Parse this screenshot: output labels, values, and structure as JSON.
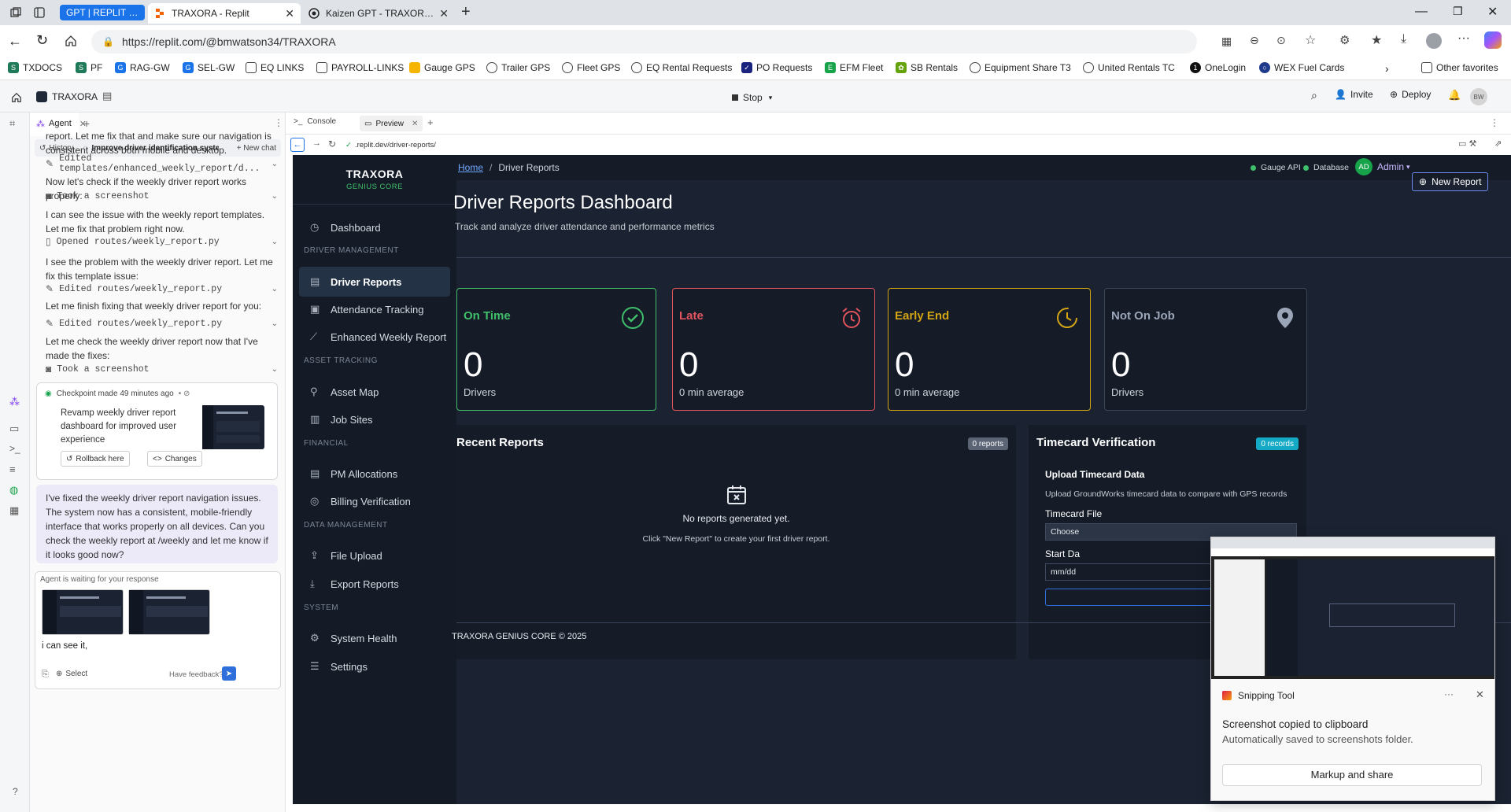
{
  "browser": {
    "tabs": [
      {
        "label": "GPT | REPLIT | BUILDIN"
      },
      {
        "label": "TRAXORA - Replit"
      },
      {
        "label": "Kaizen GPT - TRAXORA Kaizen Int"
      }
    ],
    "url": "https://replit.com/@bmwatson34/TRAXORA",
    "favorites": [
      "TXDOCS",
      "PF",
      "RAG-GW",
      "SEL-GW",
      "EQ LINKS",
      "PAYROLL-LINKS",
      "Gauge GPS",
      "Trailer GPS",
      "Fleet GPS",
      "EQ Rental Requests",
      "PO Requests",
      "EFM Fleet",
      "SB Rentals",
      "Equipment Share T3",
      "United Rentals TC",
      "OneLogin",
      "WEX Fuel Cards"
    ],
    "other_favorites": "Other favorites"
  },
  "replit": {
    "project": "TRAXORA",
    "stop_label": "Stop",
    "invite_label": "Invite",
    "deploy_label": "Deploy",
    "avatar_initials": "BW",
    "agent_tab": "Agent",
    "console_tab": "Console",
    "preview_tab": "Preview",
    "history_label": "History",
    "chat_title": "Improve driver identification syste...",
    "new_chat_label": "+ New chat",
    "preview_url": ".replit.dev/driver-reports/",
    "help": "?"
  },
  "agent": {
    "messages": [
      {
        "type": "text",
        "text": "report. Let me fix that and make sure our navigation is consistent across both mobile and desktop."
      },
      {
        "type": "tool",
        "icon": "edit-icon",
        "text": "Edited templates/enhanced_weekly_report/d..."
      },
      {
        "type": "text",
        "text": "Now let's check if the weekly driver report works properly:"
      },
      {
        "type": "tool",
        "icon": "camera-icon",
        "text": "Took a screenshot"
      },
      {
        "type": "text",
        "text": "I can see the issue with the weekly report templates. Let me fix that problem right now."
      },
      {
        "type": "tool",
        "icon": "file-icon",
        "text": "Opened routes/weekly_report.py"
      },
      {
        "type": "text",
        "text": "I see the problem with the weekly driver report. Let me fix this template issue:"
      },
      {
        "type": "tool",
        "icon": "edit-icon",
        "text": "Edited routes/weekly_report.py"
      },
      {
        "type": "text",
        "text": "Let me finish fixing that weekly driver report for you:"
      },
      {
        "type": "tool",
        "icon": "edit-icon",
        "text": "Edited routes/weekly_report.py"
      },
      {
        "type": "text",
        "text": "Let me check the weekly driver report now that I've made the fixes:"
      },
      {
        "type": "tool",
        "icon": "camera-icon",
        "text": "Took a screenshot"
      }
    ],
    "checkpoint": {
      "header": "Checkpoint made 49 minutes ago",
      "description": "Revamp weekly driver report dashboard for improved user experience",
      "rollback_label": "Rollback here",
      "changes_label": "Changes"
    },
    "final_message": "I've fixed the weekly driver report navigation issues. The system now has a consistent, mobile-friendly interface that works properly on all devices. Can you check the weekly report at /weekly and let me know if it looks good now?",
    "waiting_label": "Agent is waiting for your response",
    "input_value": "i can see it,",
    "select_label": "Select",
    "feedback_label": "Have feedback?"
  },
  "app": {
    "brand": "TRAXORA",
    "brand_sub": "GENIUS CORE",
    "breadcrumb_home": "Home",
    "breadcrumb_sep": "/",
    "breadcrumb_current": "Driver Reports",
    "status": {
      "gauge_api": "Gauge API",
      "database": "Database"
    },
    "user_initials": "AD",
    "user_name": "Admin",
    "title": "Driver Reports Dashboard",
    "subtitle": "Track and analyze driver attendance and performance metrics",
    "new_report_label": "New Report",
    "nav": {
      "dashboard": "Dashboard",
      "sec_driver": "DRIVER MANAGEMENT",
      "driver_reports": "Driver Reports",
      "attendance": "Attendance Tracking",
      "enhanced_weekly": "Enhanced Weekly Report",
      "sec_asset": "ASSET TRACKING",
      "asset_map": "Asset Map",
      "job_sites": "Job Sites",
      "sec_financial": "FINANCIAL",
      "pm_allocations": "PM Allocations",
      "billing": "Billing Verification",
      "sec_data": "DATA MANAGEMENT",
      "file_upload": "File Upload",
      "export_reports": "Export Reports",
      "sec_system": "SYSTEM",
      "system_health": "System Health",
      "settings": "Settings"
    },
    "cards": [
      {
        "title": "On Time",
        "value": "0",
        "sub": "Drivers",
        "color": "#3fbf6a"
      },
      {
        "title": "Late",
        "value": "0",
        "sub": "0 min average",
        "color": "#e2545e"
      },
      {
        "title": "Early End",
        "value": "0",
        "sub": "0 min average",
        "color": "#d3a514"
      },
      {
        "title": "Not On Job",
        "value": "0",
        "sub": "Drivers",
        "color": "#9aa6b8"
      }
    ],
    "recent": {
      "title": "Recent Reports",
      "badge": "0 reports",
      "empty": "No reports generated yet.",
      "hint": "Click \"New Report\" to create your first driver report."
    },
    "timecard": {
      "title": "Timecard Verification",
      "badge": "0 records",
      "upload_title": "Upload Timecard Data",
      "upload_desc": "Upload GroundWorks timecard data to compare with GPS records",
      "file_label": "Timecard File",
      "choose": "Choose",
      "start_label": "Start Da",
      "date_placeholder": "mm/dd"
    },
    "footer": "TRAXORA GENIUS CORE © 2025"
  },
  "toast": {
    "app_name": "Snipping Tool",
    "title": "Screenshot copied to clipboard",
    "subtitle": "Automatically saved to screenshots folder.",
    "button": "Markup and share",
    "more": "···"
  }
}
